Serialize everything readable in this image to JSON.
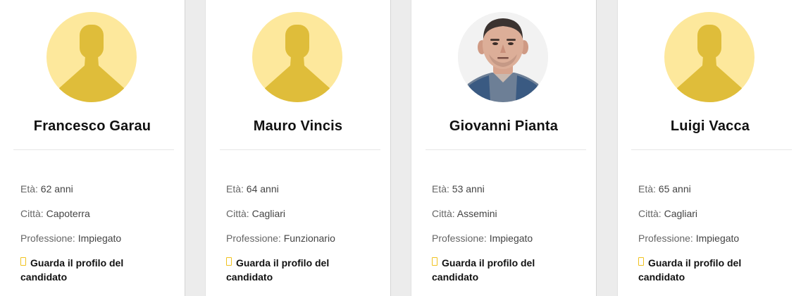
{
  "candidates": [
    {
      "name": "Francesco Garau",
      "age_label": "Età: ",
      "age": "62 anni",
      "city_label": "Città: ",
      "city": "Capoterra",
      "profession_label": "Professione: ",
      "profession": "Impiegato",
      "link_text": "Guarda il profilo del candidato",
      "avatar": "placeholder-person-icon"
    },
    {
      "name": "Mauro Vincis",
      "age_label": "Età: ",
      "age": "64 anni",
      "city_label": "Città: ",
      "city": "Cagliari",
      "profession_label": "Professione: ",
      "profession": "Funzionario",
      "link_text": "Guarda il profilo del candidato",
      "avatar": "placeholder-person-icon"
    },
    {
      "name": "Giovanni Pianta",
      "age_label": "Età: ",
      "age": "53 anni",
      "city_label": "Città: ",
      "city": "Assemini",
      "profession_label": "Professione: ",
      "profession": "Impiegato",
      "link_text": "Guarda il profilo del candidato",
      "avatar": "photo"
    },
    {
      "name": "Luigi Vacca",
      "age_label": "Età: ",
      "age": "65 anni",
      "city_label": "Città: ",
      "city": "Cagliari",
      "profession_label": "Professione: ",
      "profession": "Impiegato",
      "link_text": "Guarda il profilo del candidato",
      "avatar": "placeholder-person-icon"
    }
  ],
  "colors": {
    "avatar_bg": "#fde89c",
    "avatar_silhouette": "#dfbd3a",
    "link_icon": "#f0c21e",
    "page_bg": "#ececec"
  }
}
